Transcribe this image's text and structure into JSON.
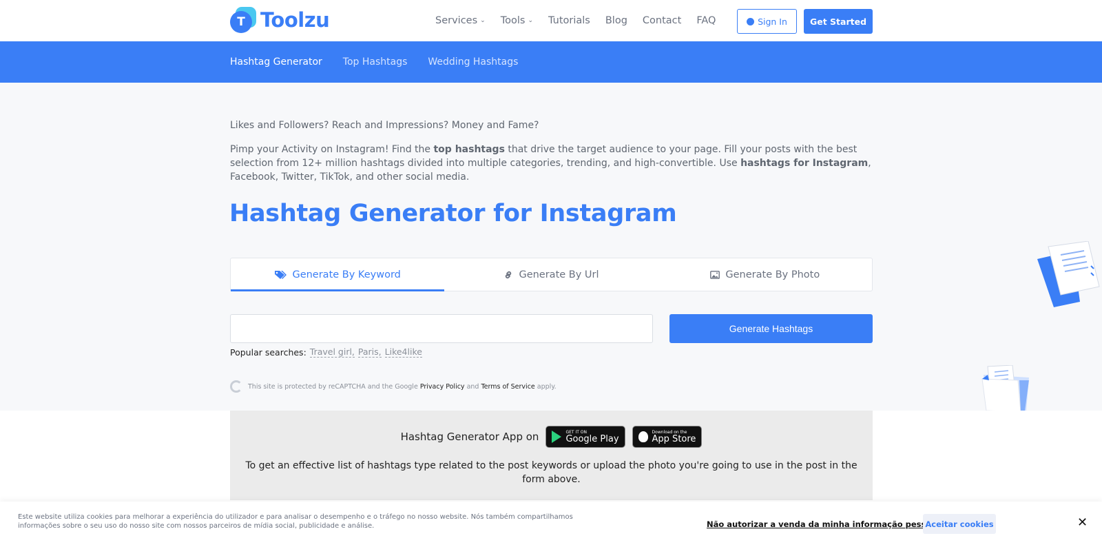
{
  "header": {
    "logo_letter": "T",
    "logo_text": "Toolzu",
    "nav": [
      {
        "label": "Services",
        "has_dropdown": true
      },
      {
        "label": "Tools",
        "has_dropdown": true
      },
      {
        "label": "Tutorials",
        "has_dropdown": false
      },
      {
        "label": "Blog",
        "has_dropdown": false
      },
      {
        "label": "Contact",
        "has_dropdown": false
      },
      {
        "label": "FAQ",
        "has_dropdown": false
      }
    ],
    "sign_in_label": "Sign In",
    "get_started_label": "Get Started"
  },
  "subnav": {
    "items": [
      "Hashtag Generator",
      "Top Hashtags",
      "Wedding Hashtags"
    ],
    "active_index": 0
  },
  "intro": {
    "line1": "Likes and Followers? Reach and Impressions? Money and Fame?",
    "p_a": "Pimp your Activity on Instagram! Find the ",
    "p_b": "top hashtags",
    "p_c": " that drive the target audience to your page. Fill your posts with the best selection from 12+ million hashtags divided into multiple categories, trending, and high-convertible. Use ",
    "p_d": "hashtags for Instagram",
    "p_e": ", Facebook, Twitter, TikTok, and other social media."
  },
  "page_title": "Hashtag Generator for Instagram",
  "tabs": [
    {
      "label": "Generate By Keyword",
      "icon": "tags-icon"
    },
    {
      "label": "Generate By Url",
      "icon": "link-icon"
    },
    {
      "label": "Generate By Photo",
      "icon": "image-icon"
    }
  ],
  "active_tab": 0,
  "search": {
    "value": "",
    "button_label": "Generate Hashtags"
  },
  "popular": {
    "label": "Popular searches:",
    "links": [
      "Travel girl,",
      "Paris,",
      "Like4like"
    ]
  },
  "recaptcha": {
    "text_a": "This site is protected by reCAPTCHA and the Google ",
    "privacy": "Privacy Policy",
    "and": " and ",
    "terms": "Terms of Service",
    "apply": " apply."
  },
  "app": {
    "label": "Hashtag Generator App on",
    "google_small": "GET IT ON",
    "google_big": "Google Play",
    "apple_small": "Download on the",
    "apple_big": "App Store",
    "description": "To get an effective list of hashtags type related to the post keywords or upload the photo you're going to use in the post in the form above."
  },
  "cookie": {
    "text": "Este website utiliza cookies para melhorar a experiência do utilizador e para analisar o desempenho e o tráfego no nosso website. Nós também compartilhamos informações sobre o seu uso do nosso site com nossos parceiros de mídia social, publicidade e análise.",
    "optout_label": "Não autorizar a venda da minha informação pessoal.",
    "accept_label": "Aceitar cookies",
    "close_symbol": "✕"
  },
  "colors": {
    "brand_blue": "#3a7ef6",
    "background": "#f7f8fa"
  }
}
